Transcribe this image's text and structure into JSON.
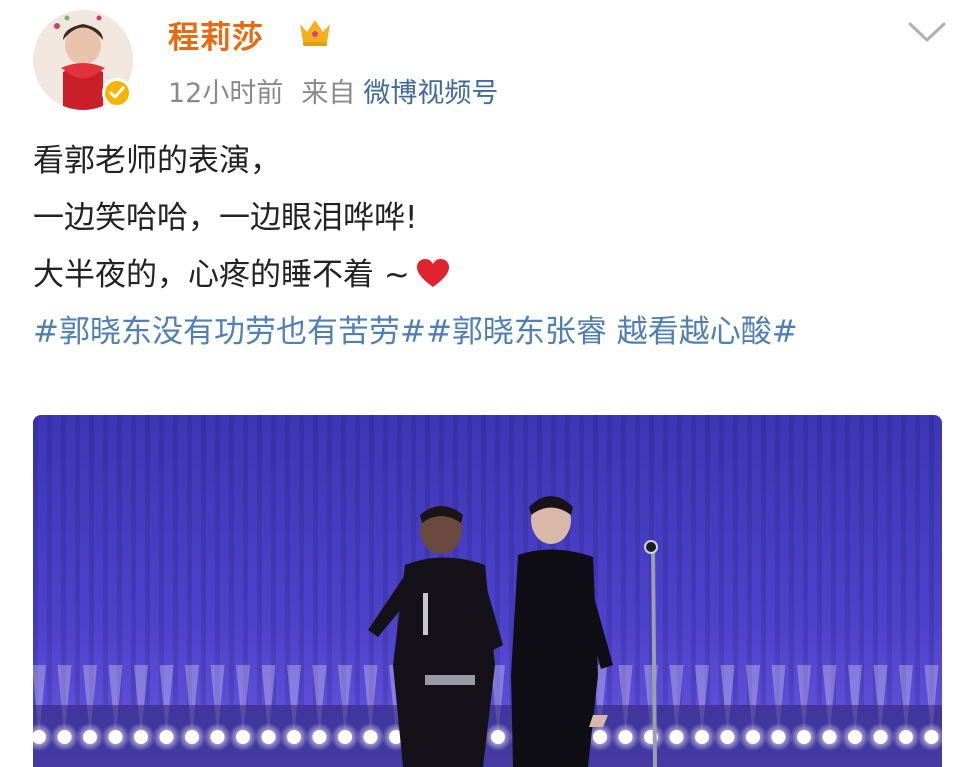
{
  "header": {
    "username": "程莉莎",
    "timestamp": "12小时前",
    "from_label": "来自",
    "source": "微博视频号",
    "icons": [
      "avatar",
      "verified-badge",
      "crown-icon",
      "chevron-down-icon"
    ]
  },
  "post": {
    "lines": [
      "看郭老师的表演，",
      "一边笑哈哈，一边眼泪哗哗!",
      "大半夜的，心疼的睡不着 ~"
    ],
    "emoji": "heart-icon",
    "topics": [
      "#郭晓东没有功劳也有苦劳#",
      "#郭晓东张睿 越看越心酸#"
    ]
  },
  "media": {
    "type": "concert-video",
    "colors": {
      "background": "#4b3fc2",
      "lights": "#ffffff"
    }
  },
  "colors": {
    "username": "#e8690f",
    "meta_gray": "#8a8a8a",
    "source_blue": "#3f6a9b",
    "topic_blue": "#4f7fb3",
    "badge": "#f5b400"
  }
}
